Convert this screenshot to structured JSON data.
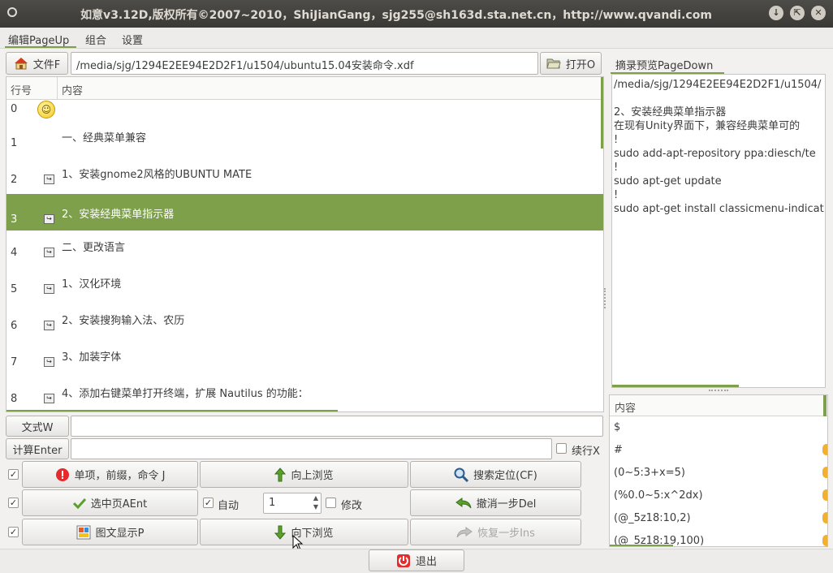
{
  "window": {
    "title": "如意v3.12D,版权所有©2007~2010，ShiJianGang，sjg255@sh163d.sta.net.cn，http://www.qvandi.com"
  },
  "menu": [
    "编辑PageUp",
    "组合",
    "设置"
  ],
  "toolbar": {
    "file_button": "文件F",
    "path": "/media/sjg/1294E2EE94E2D2F1/u1504/ubuntu15.04安装命令.xdf",
    "open_button": "打开O"
  },
  "table": {
    "col_line": "行号",
    "col_content": "内容",
    "rows": [
      {
        "num": "0",
        "text": ""
      },
      {
        "num": "1",
        "text": "一、经典菜单兼容"
      },
      {
        "num": "2",
        "text": "1、安装gnome2风格的UBUNTU MATE"
      },
      {
        "num": "3",
        "text": "2、安装经典菜单指示器"
      },
      {
        "num": "4",
        "text": "二、更改语言"
      },
      {
        "num": "5",
        "text": "1、汉化环境"
      },
      {
        "num": "6",
        "text": "2、安装搜狗输入法、农历"
      },
      {
        "num": "7",
        "text": "3、加装字体"
      },
      {
        "num": "8",
        "text": "4、添加右键菜单打开终端，扩展 Nautilus 的功能："
      }
    ],
    "selected_index": 3
  },
  "preview": {
    "tab_label": "摘录预览PageDown",
    "lines": [
      "/media/sjg/1294E2EE94E2D2F1/u1504/",
      "",
      "2、安装经典菜单指示器",
      "在现有Unity界面下，兼容经典菜单可的",
      "!",
      "sudo add-apt-repository ppa:diesch/te",
      "!",
      "sudo apt-get update",
      "!",
      "sudo apt-get install classicmenu-indicat"
    ]
  },
  "inputs": {
    "text_button": "文式W",
    "text_value": "",
    "calc_button": "计算Enter",
    "calc_value": "",
    "continue_label": "续行X"
  },
  "actions": {
    "single_item": "单项，前缀，命令 J",
    "browse_up": "向上浏览",
    "search": "搜索定位(CF)",
    "select_page": "选中页AEnt",
    "auto_label": "自动",
    "auto_value": "1",
    "modify_label": "修改",
    "undo": "撤消一步Del",
    "image_text": "图文显示P",
    "browse_down": "向下浏览",
    "redo": "恢复一步Ins",
    "exit": "退出"
  },
  "content_list": {
    "header": "内容",
    "items": [
      "$",
      "#",
      "(0~5:3+x=5)",
      "(%0.0~5:x^2dx)",
      "(@_5z18:10,2)",
      "(@_5z18:19,100)"
    ]
  },
  "colors": {
    "accent_green": "#7ea04b",
    "titlebar": "#3a3936"
  }
}
